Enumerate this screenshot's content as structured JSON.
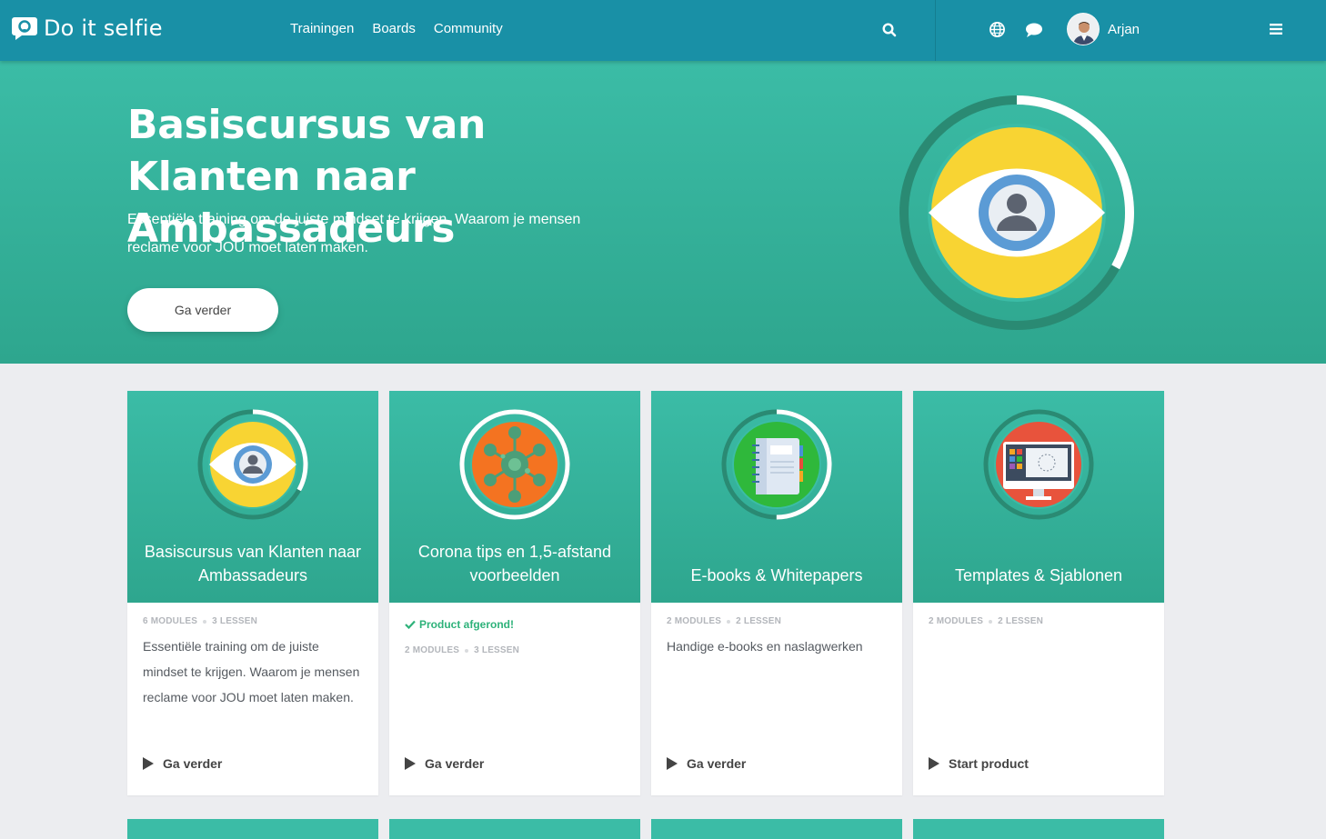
{
  "app": {
    "name": "Do it selfie"
  },
  "nav": {
    "links": [
      "Trainingen",
      "Boards",
      "Community"
    ],
    "user_name": "Arjan"
  },
  "icons": {
    "logo": "chat-bubble-logo-icon",
    "search": "search-icon",
    "globe": "globe-icon",
    "chat": "chat-icon",
    "menu": "hamburger-menu-icon",
    "play": "play-icon",
    "check": "check-icon"
  },
  "colors": {
    "nav": "#1990a6",
    "teal": "#3bbca6",
    "teal_dark": "#2a8a73",
    "yellow": "#f8d433",
    "success": "#2eb27a"
  },
  "hero": {
    "title": "Basiscursus van Klanten naar Ambassadeurs",
    "description": "Essentiële training om de juiste mindset te krijgen. Waarom je mensen reclame voor JOU moet laten maken.",
    "button": "Ga verder",
    "progress": 0.33
  },
  "cards": [
    {
      "title": "Basiscursus van Klanten naar Ambassadeurs",
      "completed": "",
      "modules": "6 MODULES",
      "lessons": "3 LESSEN",
      "description": "Essentiële training om de juiste mindset te krijgen. Waarom je mensen reclame voor JOU moet laten maken.",
      "cta": "Ga verder",
      "icon": "eye-user-icon",
      "progress": 0.33
    },
    {
      "title": "Corona tips en 1,5-afstand voorbeelden",
      "completed": "Product afgerond!",
      "modules": "2 MODULES",
      "lessons": "3 LESSEN",
      "description": "",
      "cta": "Ga verder",
      "icon": "virus-icon",
      "progress": 1
    },
    {
      "title": "E-books & Whitepapers",
      "completed": "",
      "modules": "2 MODULES",
      "lessons": "2 LESSEN",
      "description": "Handige e-books en naslagwerken",
      "cta": "Ga verder",
      "icon": "notebook-icon",
      "progress": 0.5
    },
    {
      "title": "Templates & Sjablonen",
      "completed": "",
      "modules": "2 MODULES",
      "lessons": "2 LESSEN",
      "description": "",
      "cta": "Start product",
      "icon": "monitor-template-icon",
      "progress": 0
    }
  ]
}
